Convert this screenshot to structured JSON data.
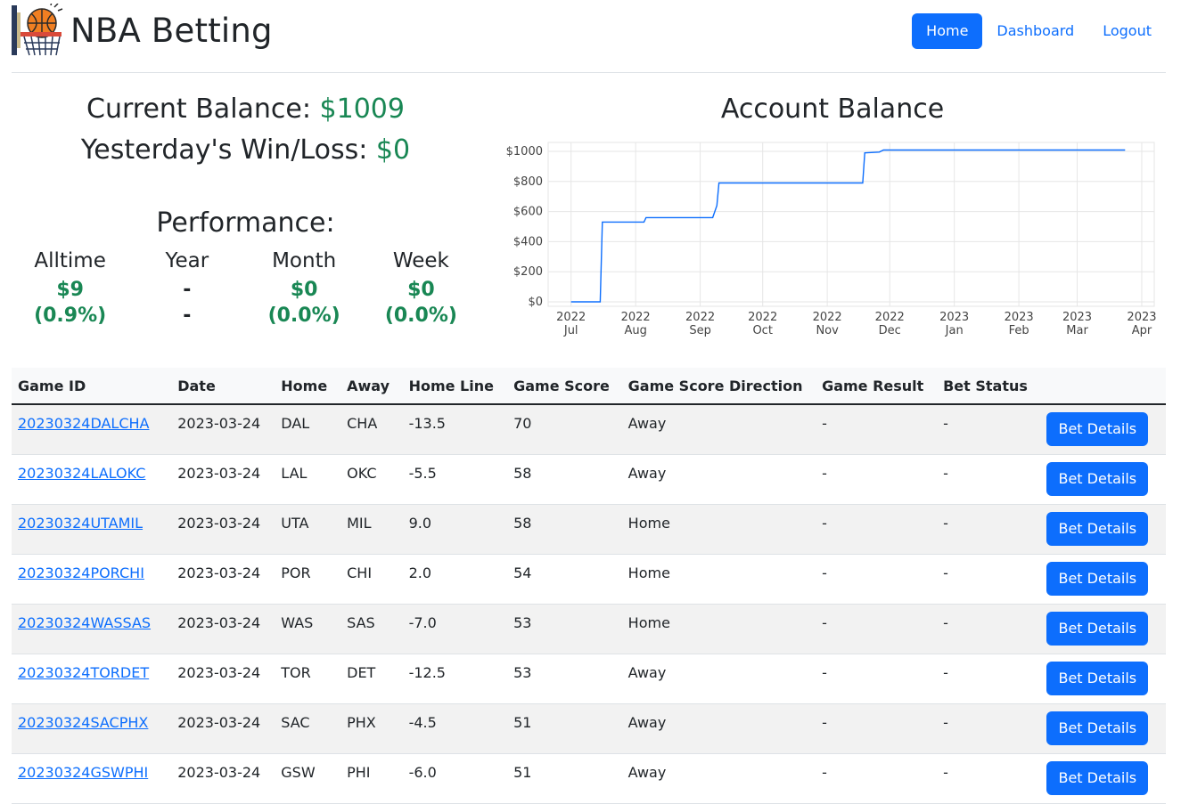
{
  "brand": {
    "title": "NBA Betting"
  },
  "nav": {
    "items": [
      "Home",
      "Dashboard",
      "Logout"
    ]
  },
  "balance": {
    "current_label": "Current Balance:",
    "current_value": "$1009",
    "yesterday_label": "Yesterday's Win/Loss:",
    "yesterday_value": "$0"
  },
  "performance": {
    "title": "Performance:",
    "columns": [
      {
        "label": "Alltime",
        "value": "$9",
        "pct": "(0.9%)"
      },
      {
        "label": "Year",
        "value": "-",
        "pct": "-"
      },
      {
        "label": "Month",
        "value": "$0",
        "pct": "(0.0%)"
      },
      {
        "label": "Week",
        "value": "$0",
        "pct": "(0.0%)"
      }
    ]
  },
  "chart_title": "Account Balance",
  "chart_data": {
    "type": "line",
    "title": "Account Balance",
    "xlabel": "",
    "ylabel": "",
    "ylim": [
      0,
      1000
    ],
    "y_ticks": [
      "$0",
      "$200",
      "$400",
      "$600",
      "$800",
      "$1000"
    ],
    "x_ticks": [
      [
        "2022",
        "Jul"
      ],
      [
        "2022",
        "Aug"
      ],
      [
        "2022",
        "Sep"
      ],
      [
        "2022",
        "Oct"
      ],
      [
        "2022",
        "Nov"
      ],
      [
        "2022",
        "Dec"
      ],
      [
        "2023",
        "Jan"
      ],
      [
        "2023",
        "Feb"
      ],
      [
        "2023",
        "Mar"
      ],
      [
        "2023",
        "Apr"
      ]
    ],
    "series": [
      {
        "values": [
          [
            "2022-07-01",
            0
          ],
          [
            "2022-07-15",
            0
          ],
          [
            "2022-07-16",
            530
          ],
          [
            "2022-08-05",
            530
          ],
          [
            "2022-08-06",
            560
          ],
          [
            "2022-09-07",
            560
          ],
          [
            "2022-09-09",
            640
          ],
          [
            "2022-09-10",
            790
          ],
          [
            "2022-11-18",
            790
          ],
          [
            "2022-11-19",
            990
          ],
          [
            "2022-11-26",
            995
          ],
          [
            "2022-11-28",
            1009
          ],
          [
            "2023-03-24",
            1009
          ]
        ]
      }
    ],
    "line_color": "#0d6efd",
    "grid": true
  },
  "table": {
    "headers": [
      "Game ID",
      "Date",
      "Home",
      "Away",
      "Home Line",
      "Game Score",
      "Game Score Direction",
      "Game Result",
      "Bet Status",
      ""
    ],
    "button_label": "Bet Details",
    "rows": [
      [
        "20230324DALCHA",
        "2023-03-24",
        "DAL",
        "CHA",
        "-13.5",
        "70",
        "Away",
        "-",
        "-"
      ],
      [
        "20230324LALOKC",
        "2023-03-24",
        "LAL",
        "OKC",
        "-5.5",
        "58",
        "Away",
        "-",
        "-"
      ],
      [
        "20230324UTAMIL",
        "2023-03-24",
        "UTA",
        "MIL",
        "9.0",
        "58",
        "Home",
        "-",
        "-"
      ],
      [
        "20230324PORCHI",
        "2023-03-24",
        "POR",
        "CHI",
        "2.0",
        "54",
        "Home",
        "-",
        "-"
      ],
      [
        "20230324WASSAS",
        "2023-03-24",
        "WAS",
        "SAS",
        "-7.0",
        "53",
        "Home",
        "-",
        "-"
      ],
      [
        "20230324TORDET",
        "2023-03-24",
        "TOR",
        "DET",
        "-12.5",
        "53",
        "Away",
        "-",
        "-"
      ],
      [
        "20230324SACPHX",
        "2023-03-24",
        "SAC",
        "PHX",
        "-4.5",
        "51",
        "Away",
        "-",
        "-"
      ],
      [
        "20230324GSWPHI",
        "2023-03-24",
        "GSW",
        "PHI",
        "-6.0",
        "51",
        "Away",
        "-",
        "-"
      ]
    ]
  }
}
